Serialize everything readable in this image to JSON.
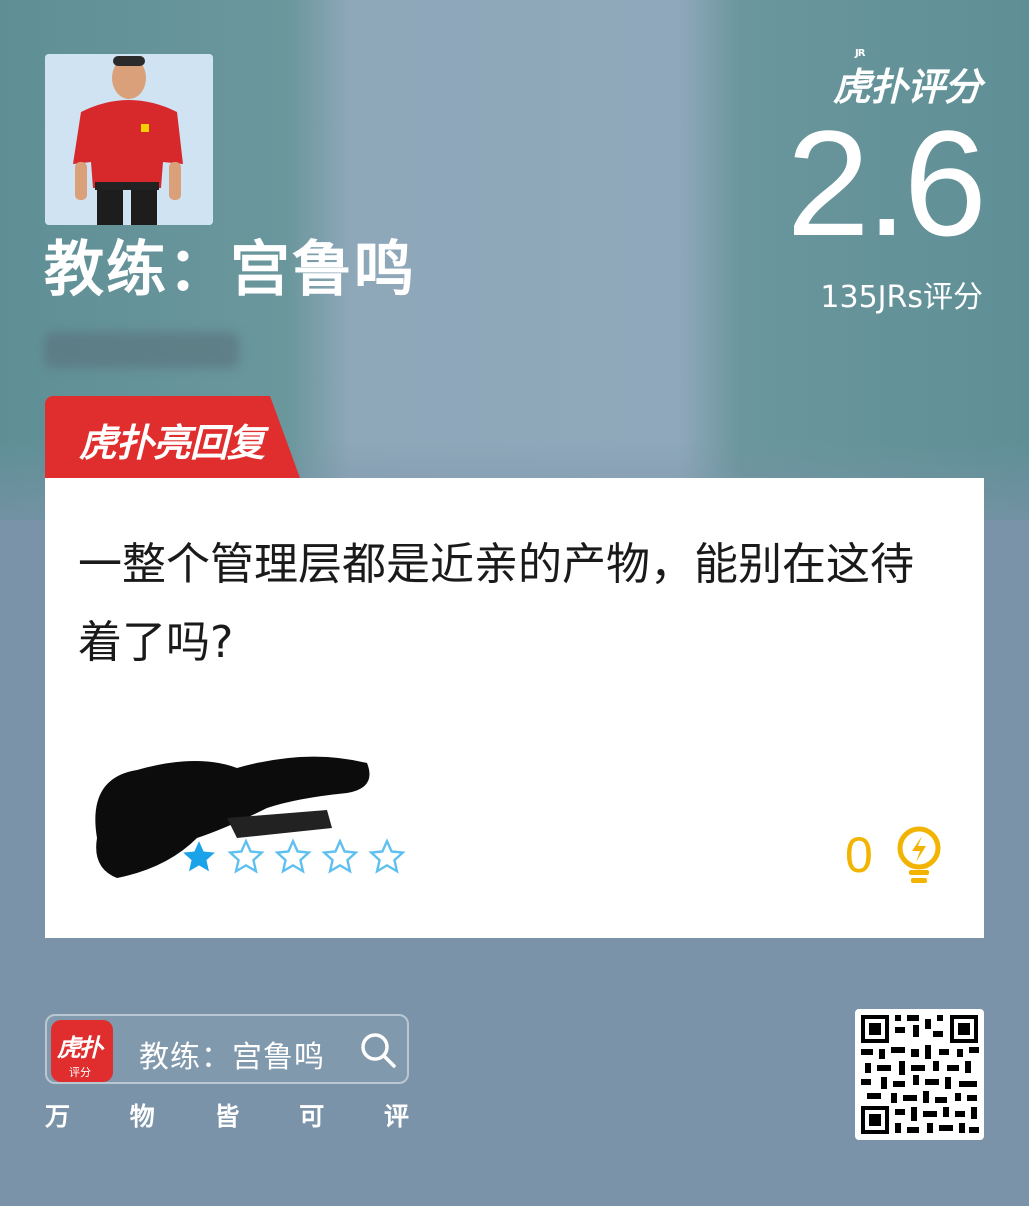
{
  "header": {
    "title": "教练：宫鲁鸣",
    "logo_text": "虎扑评分",
    "logo_badge": "JR",
    "score": "2.6",
    "rating_count": "135JRs评分"
  },
  "tag": {
    "label": "虎扑亮回复"
  },
  "comment": {
    "text": "一整个管理层都是近亲的产物，能别在这待着了吗?",
    "rating": {
      "filled": 1,
      "total": 5
    },
    "light_count": "0"
  },
  "footer": {
    "app_icon_text": "虎扑",
    "app_icon_sub": "评分",
    "search_text": "教练：宫鲁鸣",
    "slogan": [
      "万",
      "物",
      "皆",
      "可",
      "评"
    ]
  },
  "colors": {
    "accent_red": "#e02d2d",
    "star_blue": "#1aa3e8",
    "light_yellow": "#f2b400"
  }
}
